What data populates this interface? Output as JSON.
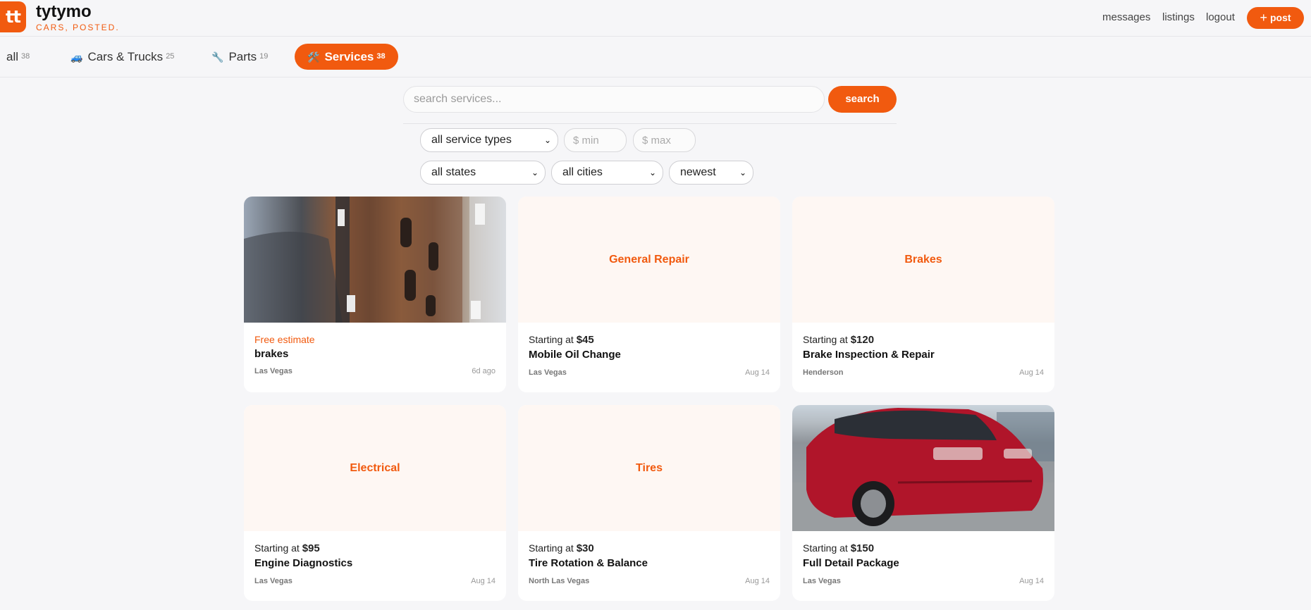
{
  "brand": {
    "logo_text": "tt",
    "name": "tytymo",
    "tagline": "CARS, POSTED."
  },
  "top_nav": {
    "messages": "messages",
    "listings": "listings",
    "logout": "logout",
    "post_label": "post"
  },
  "tabs": [
    {
      "label": "all",
      "count": "38",
      "icon": ""
    },
    {
      "label": "Cars & Trucks",
      "count": "25",
      "icon": "🚙"
    },
    {
      "label": "Parts",
      "count": "19",
      "icon": "🔧"
    },
    {
      "label": "Services",
      "count": "38",
      "icon": "🛠️"
    }
  ],
  "search": {
    "placeholder": "search services...",
    "button": "search"
  },
  "filters": {
    "service_type": "all service types",
    "min_placeholder": "$ min",
    "max_placeholder": "$ max",
    "state": "all states",
    "city": "all cities",
    "sort": "newest"
  },
  "listings": [
    {
      "price_prefix": "",
      "price": "",
      "free_label": "Free estimate",
      "title": "brakes",
      "location": "Las Vegas",
      "date": "6d ago",
      "placeholder_label": "",
      "image": "brake-rotor-photo"
    },
    {
      "price_prefix": "Starting at ",
      "price": "$45",
      "title": "Mobile Oil Change",
      "location": "Las Vegas",
      "date": "Aug 14",
      "placeholder_label": "General Repair"
    },
    {
      "price_prefix": "Starting at ",
      "price": "$120",
      "title": "Brake Inspection & Repair",
      "location": "Henderson",
      "date": "Aug 14",
      "placeholder_label": "Brakes"
    },
    {
      "price_prefix": "Starting at ",
      "price": "$95",
      "title": "Engine Diagnostics",
      "location": "Las Vegas",
      "date": "Aug 14",
      "placeholder_label": "Electrical"
    },
    {
      "price_prefix": "Starting at ",
      "price": "$30",
      "title": "Tire Rotation & Balance",
      "location": "North Las Vegas",
      "date": "Aug 14",
      "placeholder_label": "Tires"
    },
    {
      "price_prefix": "Starting at ",
      "price": "$150",
      "title": "Full Detail Package",
      "location": "Las Vegas",
      "date": "Aug 14",
      "placeholder_label": "",
      "image": "red-sedan-photo"
    }
  ],
  "colors": {
    "accent": "#f15a0f",
    "placeholder_bg": "#fef7f3",
    "page_bg": "#f6f6f8"
  }
}
